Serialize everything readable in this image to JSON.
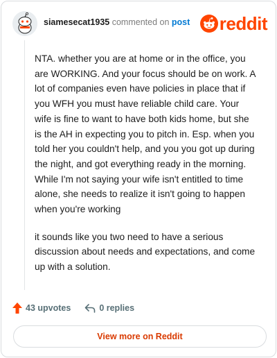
{
  "comment": {
    "username": "siamesecat1935",
    "verb": "commented on",
    "target_link": "post",
    "paragraphs": [
      "NTA. whether you are at home or in the office, you are WORKING. And your focus should be on work. A lot of companies even have policies in place that if you WFH you must have reliable child care. Your wife is fine to want to have both kids home, but she is the AH in expecting you to pitch in. Esp. when you told her you couldn't help, and you you got up during the night, and got everything ready in the morning. While I'm not saying your wife isn't entitled to time alone, she needs to realize it isn't going to happen when you're working",
      "it sounds like you two need to have a serious discussion about needs and expectations, and come up with a solution."
    ]
  },
  "brand": {
    "wordmark": "reddit",
    "color": "#ff4500"
  },
  "actions": {
    "upvotes": "43 upvotes",
    "replies": "0 replies"
  },
  "footer": {
    "view_more_label": "View more on Reddit"
  },
  "icons": {
    "avatar": "snoo-avatar-icon",
    "logo": "reddit-logo-icon",
    "upvote": "upvote-arrow-icon",
    "reply": "reply-arrow-icon"
  },
  "colors": {
    "username": "#1c1c1c",
    "link": "#0079d3",
    "action_text": "#576f76",
    "upvote_arrow": "#ff4500",
    "view_more_text": "#d93a00"
  }
}
